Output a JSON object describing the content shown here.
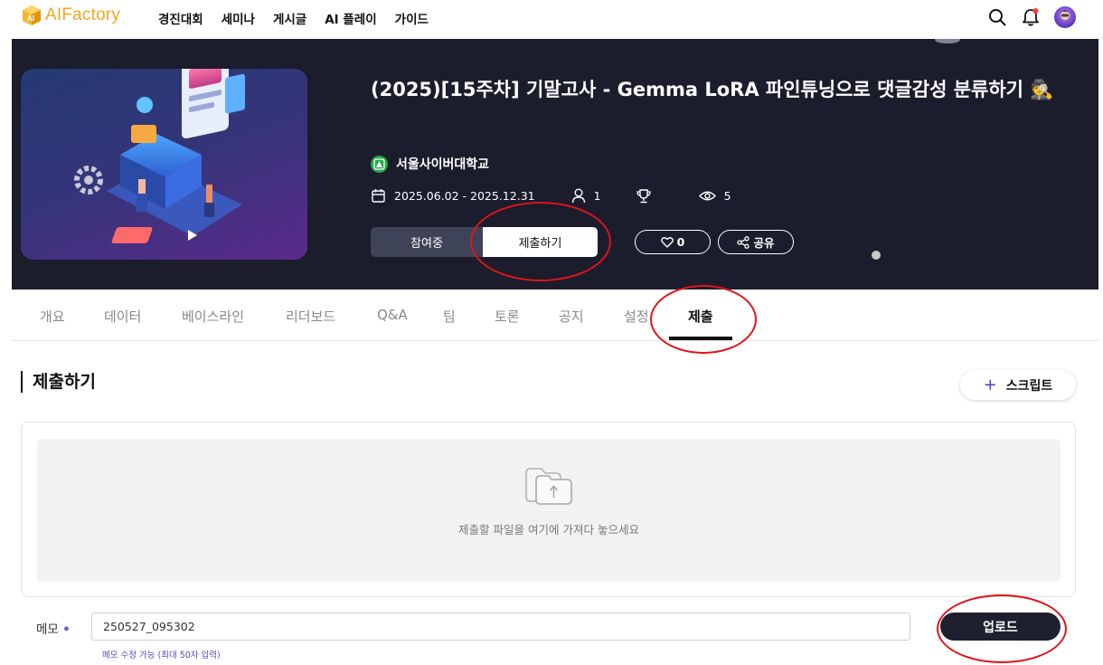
{
  "nav": {
    "logo_text": "AIFactory",
    "items": [
      {
        "label": "경진대회"
      },
      {
        "label": "세미나"
      },
      {
        "label": "게시글"
      },
      {
        "label": "AI 플레이"
      },
      {
        "label": "가이드"
      }
    ],
    "icons": [
      "search-icon",
      "notification-bell-icon",
      "user-avatar"
    ],
    "brand_color": "#f5a623"
  },
  "competition": {
    "title": "(2025)[15주차] 기말고사 - Gemma LoRA 파인튜닝으로 댓글감성 분류하기 🕵️",
    "org": "서울사이버대학교",
    "period": "2025.06.02 - 2025.12.31",
    "participants": "1",
    "views": "5",
    "join_label": "참여중",
    "submit_label": "제출하기",
    "like_count": "0",
    "share_label": "공유"
  },
  "tabs": [
    {
      "label": "개요"
    },
    {
      "label": "데이터"
    },
    {
      "label": "베이스라인"
    },
    {
      "label": "리더보드"
    },
    {
      "label": "Q&A"
    },
    {
      "label": "팀"
    },
    {
      "label": "토론"
    },
    {
      "label": "공지"
    },
    {
      "label": "설정"
    },
    {
      "label": "제출",
      "active": true
    }
  ],
  "submit_section": {
    "title": "제출하기",
    "script_button": "스크립트",
    "drop_text": "제출할 파일을 여기에 가져다 놓으세요",
    "memo_label": "메모",
    "memo_required_mark": "•",
    "memo_value": "250527_095302",
    "memo_hint": "메모 수정 가능 (최대 50자 입력)",
    "upload_label": "업로드"
  }
}
